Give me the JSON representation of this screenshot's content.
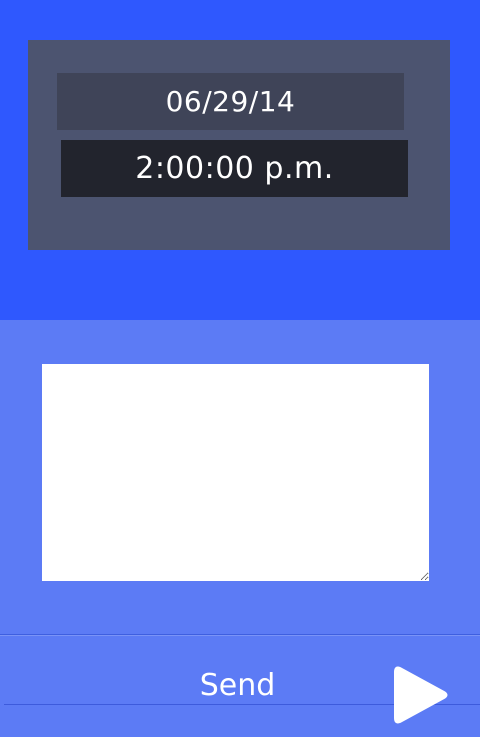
{
  "datetime": {
    "date": "06/29/14",
    "time": "2:00:00 p.m."
  },
  "message": {
    "value": ""
  },
  "send": {
    "label": "Send",
    "icon": "play-arrow-icon"
  },
  "colors": {
    "top_band": "#2f58fe",
    "panel": "#4c5470",
    "date_field": "#3f4458",
    "time_field": "#22242d",
    "bottom_band": "#5c7bf5",
    "message_box": "#ffffff"
  }
}
